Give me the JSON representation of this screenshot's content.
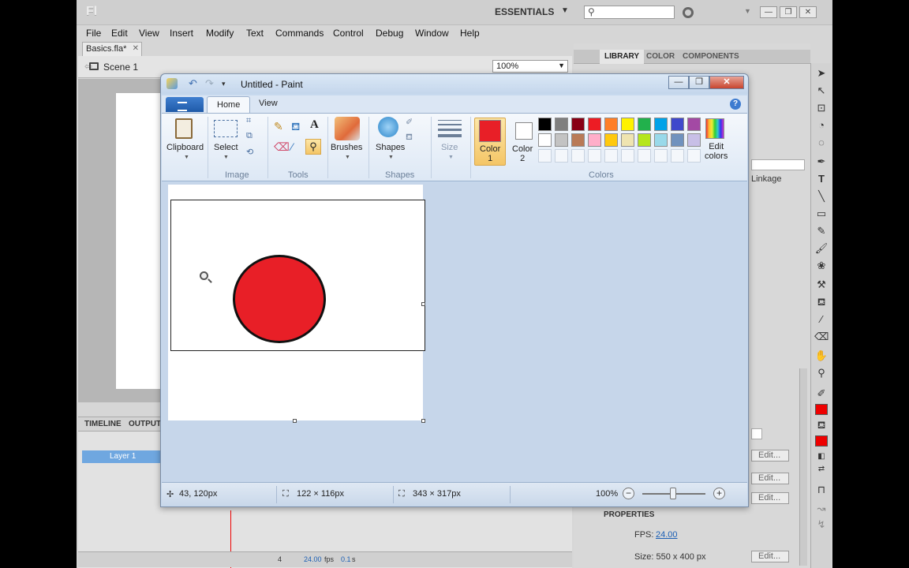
{
  "flash": {
    "logo": "Fl",
    "workspace": "ESSENTIALS",
    "menu": [
      "File",
      "Edit",
      "View",
      "Insert",
      "Modify",
      "Text",
      "Commands",
      "Control",
      "Debug",
      "Window",
      "Help"
    ],
    "doc_tab": "Basics.fla*",
    "scene": "Scene 1",
    "zoom": "100%",
    "panel_tabs": [
      "LIBRARY",
      "COLOR",
      "COMPONENTS"
    ],
    "linkage_label": "Linkage",
    "timeline_tabs": [
      "TIMELINE",
      "OUTPUT"
    ],
    "layer_name": "Layer 1",
    "timeline_status": {
      "frame": "4",
      "fps": "24.00",
      "fps_unit": "fps",
      "time": "0.1",
      "time_unit": "s"
    },
    "edit_label": "Edit...",
    "properties": {
      "header": "PROPERTIES",
      "fps_label": "FPS:",
      "fps_value": "24.00",
      "size": "Size: 550 x 400 px"
    },
    "fill_color": "#e00000"
  },
  "paint": {
    "title": "Untitled - Paint",
    "tabs": [
      "Home",
      "View"
    ],
    "groups": {
      "clipboard": "Clipboard",
      "image": "Image",
      "select": "Select",
      "tools": "Tools",
      "brushes": "Brushes",
      "shapes_btn": "Shapes",
      "shapes": "Shapes",
      "size": "Size",
      "color1": "Color\n1",
      "color2": "Color\n2",
      "colors": "Colors",
      "edit_colors": "Edit\ncolors"
    },
    "color1": "#e81f27",
    "color2": "#ffffff",
    "palette_row1": [
      "#000000",
      "#7f7f7f",
      "#880015",
      "#ed1c24",
      "#ff7f27",
      "#fff200",
      "#22b14c",
      "#00a2e8",
      "#3f48cc",
      "#a349a4"
    ],
    "palette_row2": [
      "#ffffff",
      "#c3c3c3",
      "#b97a57",
      "#ffaec9",
      "#ffc90e",
      "#efe4b0",
      "#b5e61d",
      "#99d9ea",
      "#7092be",
      "#c8bfe7"
    ],
    "status": {
      "cursor": "43, 120px",
      "selection": "122 × 116px",
      "canvas": "343 × 317px",
      "zoom": "100%"
    },
    "circle_color": "#e81f27"
  }
}
